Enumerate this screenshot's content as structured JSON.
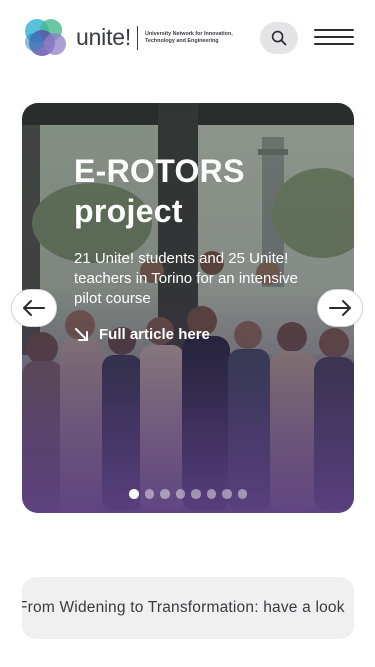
{
  "header": {
    "logo_word": "unite!",
    "logo_tagline": "University Network for Innovation, Technology and Engineering",
    "search_icon": "search-icon",
    "menu_icon": "hamburger-menu-icon"
  },
  "hero": {
    "title": "E-ROTORS project",
    "subtitle": "21 Unite! students and 25 Unite! teachers in Torino for an intensive pilot course",
    "link_label": "Full article here",
    "link_icon": "arrow-down-right-icon",
    "prev_icon": "arrow-left-icon",
    "next_icon": "arrow-right-icon",
    "slides": 8,
    "active_slide": 1,
    "overlay_color": "#6a4a94"
  },
  "ticker": {
    "text": "From Widening to Transformation: have a look"
  },
  "colors": {
    "accent": "#6a4a94",
    "text_dark": "#3a3a44",
    "button_bg": "#e4e4e6",
    "ticker_bg": "#f0f0f1"
  }
}
